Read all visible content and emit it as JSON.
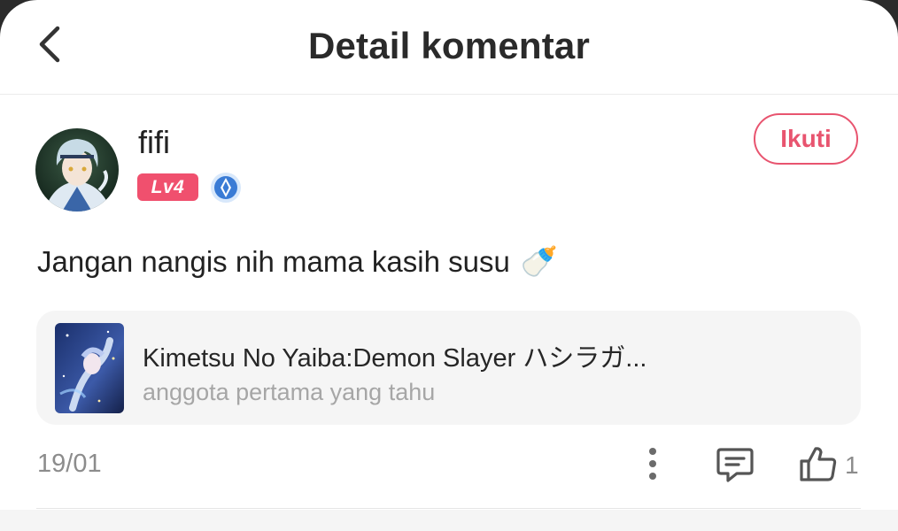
{
  "header": {
    "title": "Detail komentar",
    "back_icon": "chevron-left-icon"
  },
  "comment": {
    "author": {
      "name": "fifi",
      "level": "Lv4",
      "badge_icon": "blue-medal-icon"
    },
    "follow_label": "Ikuti",
    "text": "Jangan nangis nih mama kasih susu",
    "emoji": "🍼",
    "game": {
      "title": "Kimetsu No Yaiba:Demon Slayer ハシラガ...",
      "subtitle": "anggota pertama yang tahu"
    },
    "date": "19/01",
    "like_count": "1"
  },
  "colors": {
    "accent": "#e8546f",
    "level_badge": "#f0506e",
    "card_bg": "#f5f5f5",
    "muted_text": "#8c8c8c"
  }
}
